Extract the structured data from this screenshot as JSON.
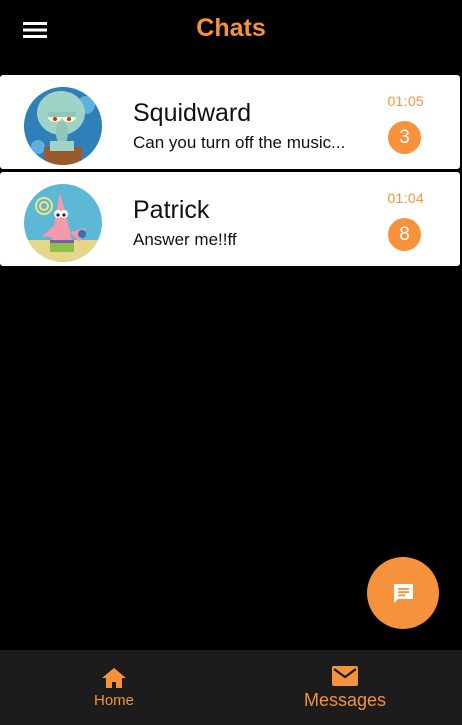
{
  "header": {
    "title": "Chats",
    "menu_icon": "hamburger-menu-icon"
  },
  "chats": [
    {
      "name": "Squidward",
      "preview": "Can you turn off the music...",
      "time": "01:05",
      "unread": "3",
      "avatar": "squidward-avatar"
    },
    {
      "name": "Patrick",
      "preview": "Answer me!!ff",
      "time": "01:04",
      "unread": "8",
      "avatar": "patrick-avatar"
    }
  ],
  "fab": {
    "icon": "chat-bubble-icon"
  },
  "bottom_nav": {
    "home_label": "Home",
    "home_icon": "home-icon",
    "messages_label": "Messages",
    "messages_icon": "mail-icon"
  },
  "colors": {
    "accent": "#f6923c",
    "background": "#000000",
    "card": "#ffffff",
    "nav_background": "#1c1c1c"
  }
}
